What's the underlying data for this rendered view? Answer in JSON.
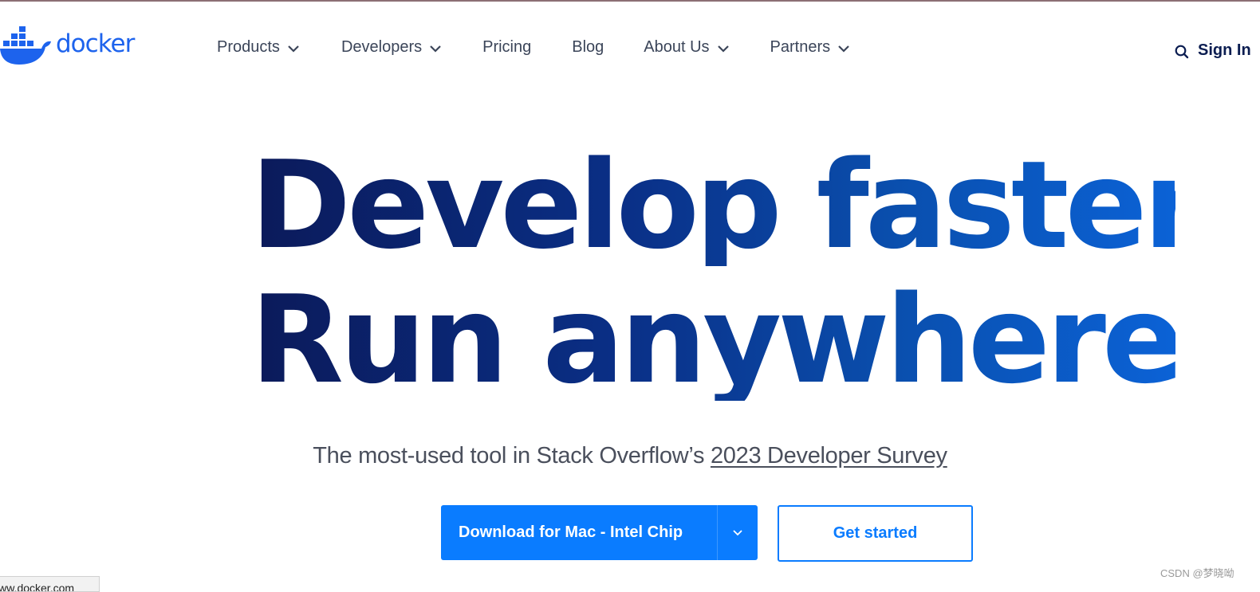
{
  "header": {
    "logo_text": "docker",
    "nav": [
      {
        "label": "Products",
        "has_dropdown": true
      },
      {
        "label": "Developers",
        "has_dropdown": true
      },
      {
        "label": "Pricing",
        "has_dropdown": false
      },
      {
        "label": "Blog",
        "has_dropdown": false
      },
      {
        "label": "About Us",
        "has_dropdown": true
      },
      {
        "label": "Partners",
        "has_dropdown": true
      }
    ],
    "search_icon": "search-icon",
    "sign_in": "Sign In"
  },
  "hero": {
    "line1": "Develop faster.",
    "line2": "Run anywhere.",
    "subtitle_prefix": "The most-used tool in Stack Overflow’s ",
    "subtitle_link": "2023 Developer Survey"
  },
  "actions": {
    "download_label": "Download for Mac - Intel Chip",
    "get_started_label": "Get started"
  },
  "status_bar": {
    "url": "www.docker.com"
  },
  "watermark": "CSDN @梦晓呦",
  "colors": {
    "brand": "#1d63ed",
    "primary_button": "#0a7cff",
    "nav_text": "#3b4559",
    "heading_dark": "#0b1a5a",
    "heading_light": "#0b62d6"
  }
}
